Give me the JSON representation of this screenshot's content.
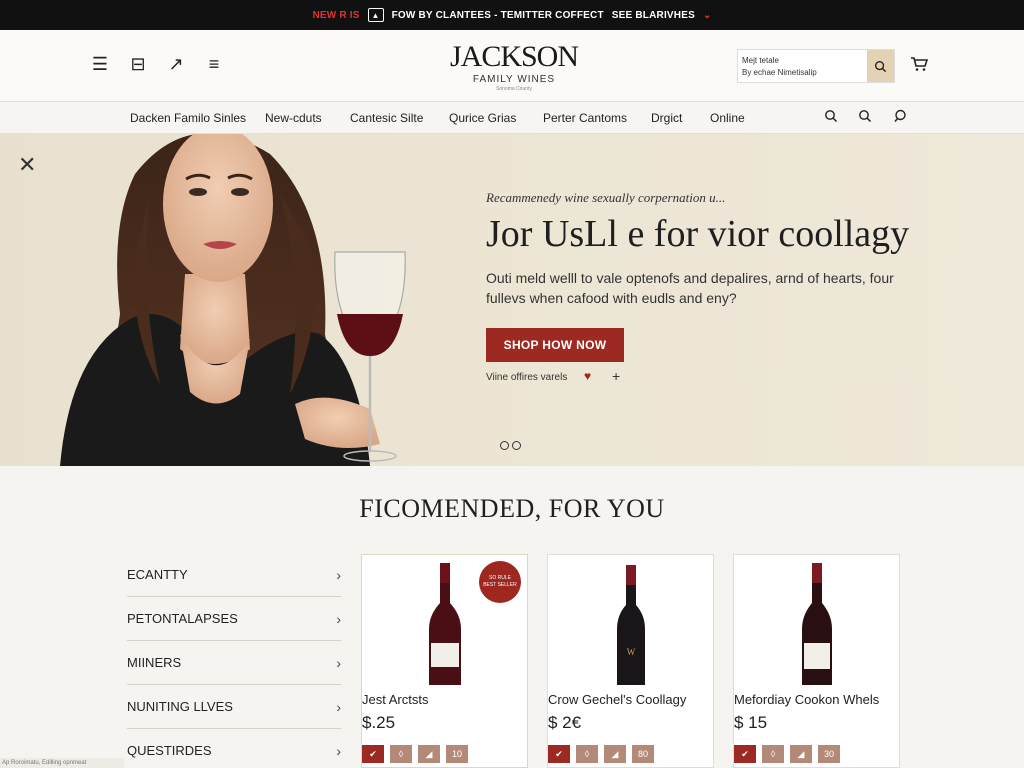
{
  "promo": {
    "new_label": "NEW R IS",
    "text": "FOW BY CLANTEES - TEMITTER COFFECT",
    "cta": "SEE BLARIVHES"
  },
  "header": {
    "brand_name": "JACKSON",
    "brand_sub": "FAMILY WINES",
    "brand_tiny": "Sonoma County",
    "search": {
      "line1": "Mejt tetale",
      "line2": "By echae Nimetisalip"
    }
  },
  "nav": {
    "items": [
      "Dacken Familo Sinles",
      "New-cduts",
      "Cantesic Silte",
      "Qurice Grias",
      "Perter Cantoms",
      "Drgict",
      "Online"
    ]
  },
  "hero": {
    "kicker": "Recammenedy wine sexually corpernation u...",
    "title": "Jor UsLl e for vior coollagy",
    "description": "Outi meld welll to vale optenofs and depalires, arnd of hearts, four fullevs when cafood with eudls and eny?",
    "cta": "SHOP HOW NOW",
    "offers": "Viine offires varels"
  },
  "recommended": {
    "title": "FICOMENDED, FOR YOU",
    "categories": [
      "ECANTTY",
      "PETONTALAPSES",
      "MIINERS",
      "NUNITING LLVES",
      "QUESTIRDES"
    ],
    "products": [
      {
        "name": "Jest Arctsts",
        "price": "$.25",
        "badge": "SO RULE BEST SELLER",
        "count": "10"
      },
      {
        "name": "Crow Gechel's Coollagy",
        "price": "$ 2€",
        "count": "80"
      },
      {
        "name": "Mefordiay Cookon Whels",
        "price": "$ 15",
        "count": "30"
      }
    ]
  },
  "status_bar": "Ap Roroimatu, Edilling opnmeat",
  "colors": {
    "accent": "#9c2a22",
    "promo_bg": "#111111",
    "hero_bg": "#ece5d4"
  }
}
